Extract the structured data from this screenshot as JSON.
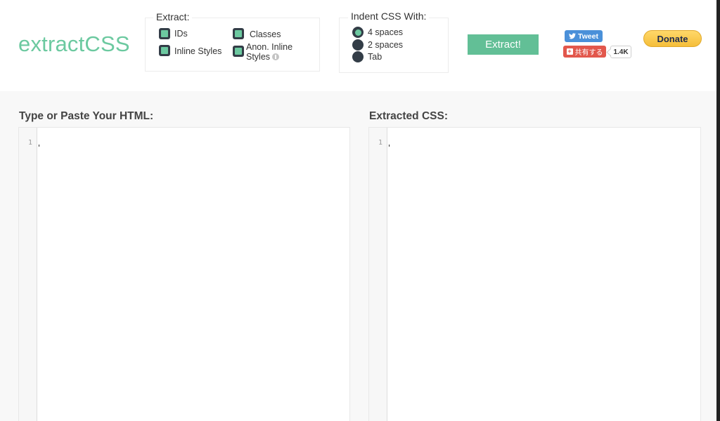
{
  "app": {
    "logo": "extractCSS"
  },
  "extract_options": {
    "legend": "Extract:",
    "items": [
      {
        "label": "IDs",
        "checked": true
      },
      {
        "label": "Classes",
        "checked": true
      },
      {
        "label": "Inline Styles",
        "checked": true
      },
      {
        "label": "Anon. Inline Styles",
        "label_line1": "Anon. Inline",
        "label_line2": "Styles",
        "checked": true
      }
    ]
  },
  "indent_options": {
    "legend": "Indent CSS With:",
    "items": [
      {
        "label": "4 spaces",
        "checked": true
      },
      {
        "label": "2 spaces",
        "checked": false
      },
      {
        "label": "Tab",
        "checked": false
      }
    ]
  },
  "actions": {
    "extract_label": "Extract!"
  },
  "social": {
    "tweet_label": "Tweet",
    "share_label": "共有する",
    "share_count": "1.4K",
    "donate_label": "Donate"
  },
  "input_panel": {
    "title": "Type or Paste Your HTML:",
    "line_number": "1"
  },
  "output_panel": {
    "title": "Extracted CSS:",
    "line_number": "1"
  },
  "colors": {
    "accent": "#6cc9a0",
    "button": "#62bf96",
    "checkbox_dark": "#333d47",
    "tweet_blue": "#4a90d9",
    "share_red": "#e2574c",
    "donate_yellow": "#f5be3a"
  }
}
